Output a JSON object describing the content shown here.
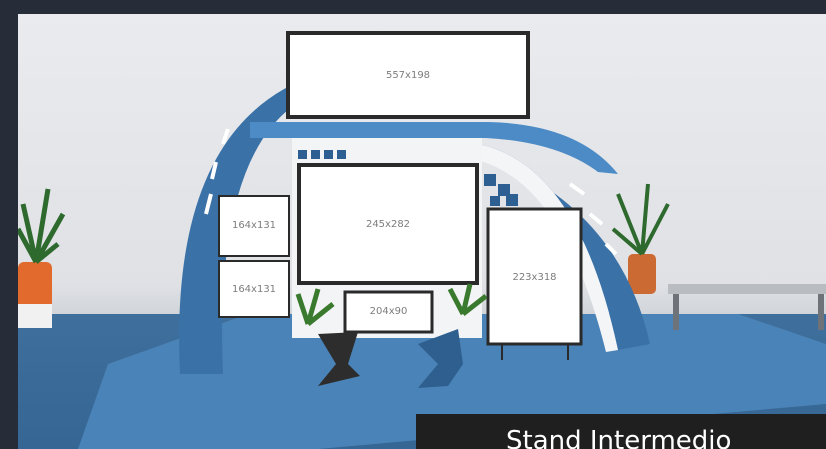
{
  "screens": {
    "top_banner": "557x198",
    "main_screen": "245x282",
    "left_upper": "164x131",
    "left_lower": "164x131",
    "right_screen": "223x318",
    "counter_screen": "204x90"
  },
  "caption": "Stand Intermedio",
  "colors": {
    "booth_blue": "#3a72a8",
    "floor_blue": "#3f6f9c",
    "wall": "#e9ebee",
    "frame": "#262d38"
  }
}
